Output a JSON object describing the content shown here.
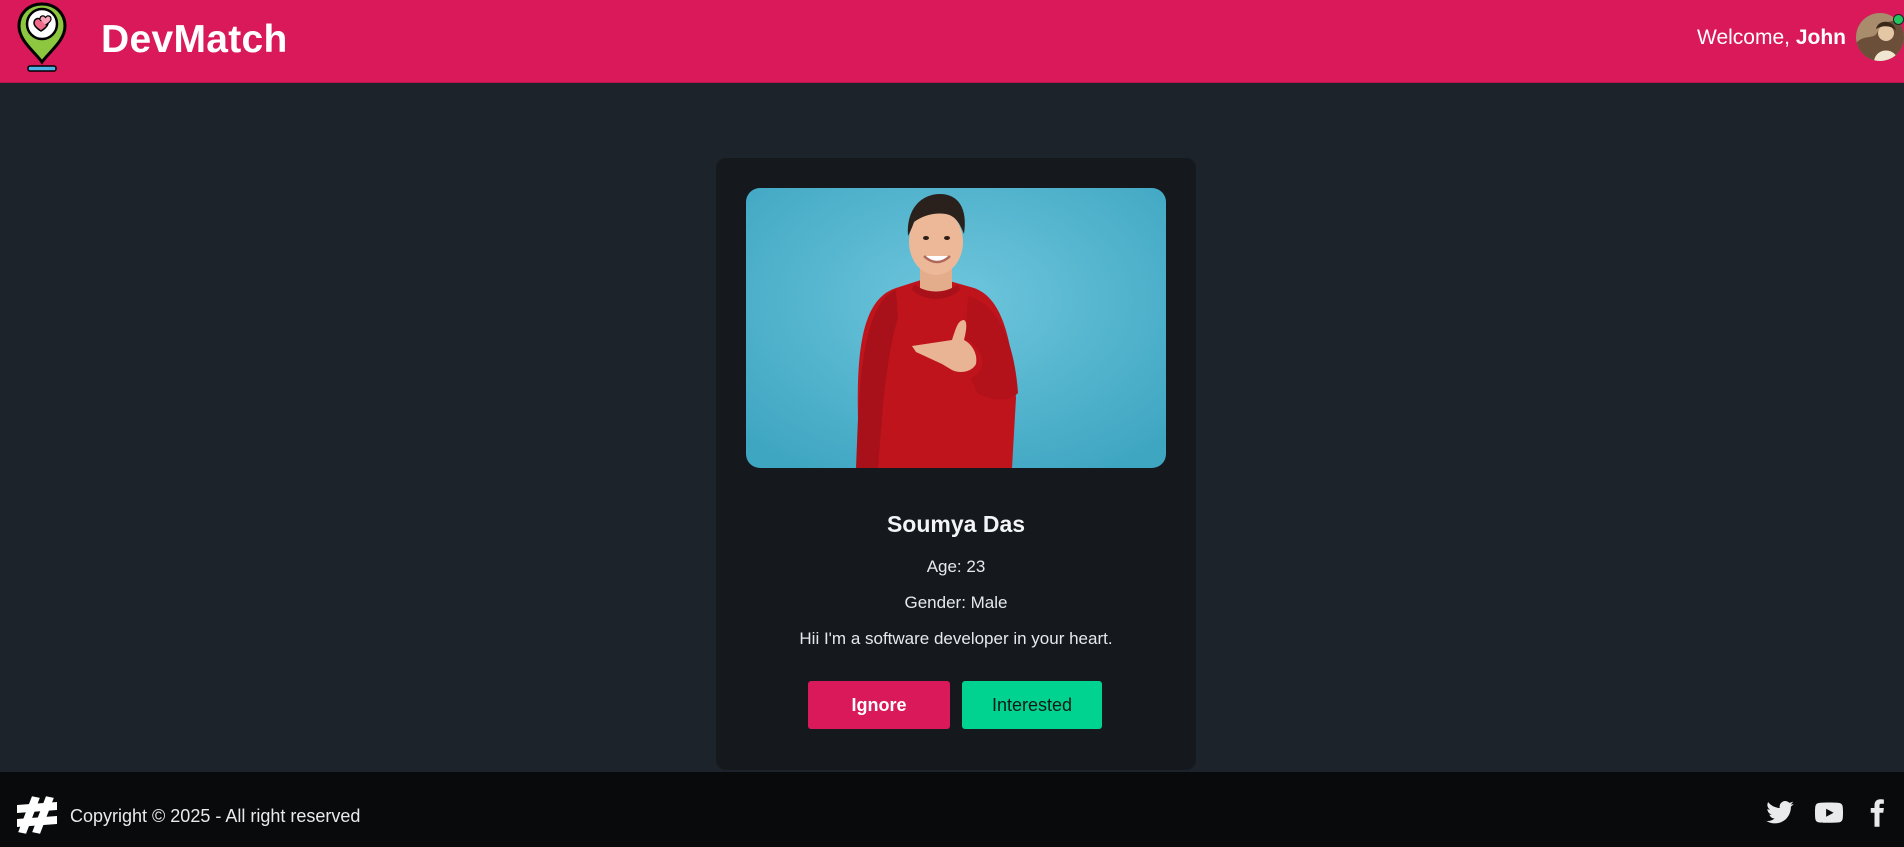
{
  "navbar": {
    "brand": "DevMatch",
    "welcome_prefix": "Welcome,",
    "user_name": "John",
    "brand_color": "#d91959"
  },
  "card": {
    "name": "Soumya Das",
    "age_text": "Age: 23",
    "gender_text": "Gender: Male",
    "about": "Hii I'm a software developer in your heart.",
    "ignore_label": "Ignore",
    "interested_label": "Interested"
  },
  "footer": {
    "copyright": "Copyright © 2025 - All right reserved",
    "social_icons": [
      "twitter-icon",
      "youtube-icon",
      "facebook-icon"
    ]
  },
  "colors": {
    "page_bg": "#1d232a",
    "card_bg": "#15191e",
    "primary": "#d91959",
    "success": "#00d390",
    "footer_bg": "#090a0b"
  }
}
